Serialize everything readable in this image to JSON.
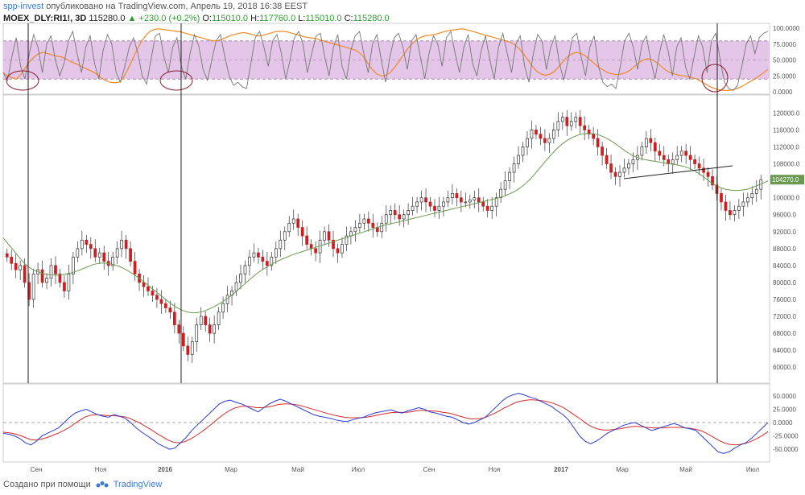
{
  "header": {
    "author": "spp-invest",
    "published_text": "опубликовано на TradingView.com, Апрель 19, 2018 16:38 EEST",
    "symbol": "MOEX_DLY:RI1!, 3D",
    "last": "115280.0",
    "change": "▲ +230.0 (+0.2%)",
    "open_label": "O:",
    "open": "115010.0",
    "high_label": "H:",
    "high": "117760.0",
    "low_label": "L:",
    "low": "115010.0",
    "close_label": "C:",
    "close": "115280.0"
  },
  "footer": {
    "created_with": "Создано при помощи",
    "brand": "TradingView",
    "logo_icon": "tradingview-logo-icon"
  },
  "colors": {
    "bull": "#7a9a5a",
    "bear": "#cc1f1f",
    "ma": "#6a9a50",
    "stoch_k": "#777777",
    "stoch_d": "#f08a24",
    "stoch_band": "#e4c6e8",
    "macd": "#2b3bd6",
    "signal": "#d62b2b",
    "price_tag": "#6a9a50"
  },
  "chart_data": [
    {
      "type": "line",
      "panel": "stochastic",
      "y_ticks": [
        "100.0000",
        "75.0000",
        "50.0000",
        "25.0000",
        "0.0000"
      ],
      "ylim": [
        0,
        100
      ],
      "bands": [
        20,
        80
      ],
      "series": [
        {
          "key": "k",
          "values": [
            30,
            18,
            55,
            85,
            40,
            20,
            60,
            90,
            70,
            30,
            75,
            88,
            50,
            25,
            45,
            80,
            95,
            60,
            30,
            70,
            88,
            45,
            20,
            65,
            90,
            75,
            30,
            15,
            40,
            70,
            85,
            60,
            25,
            12,
            50,
            88,
            92,
            55,
            30,
            70,
            85,
            40,
            20,
            60,
            90,
            72,
            35,
            18,
            50,
            80,
            90,
            55,
            25,
            10,
            15,
            8,
            5,
            45,
            85,
            95,
            70,
            40,
            80,
            90,
            60,
            20,
            50,
            85,
            95,
            75,
            30,
            60,
            88,
            92,
            55,
            25,
            70,
            90,
            40,
            20,
            65,
            88,
            95,
            60,
            30,
            75,
            90,
            50,
            15,
            55,
            85,
            92,
            70,
            35,
            80,
            90,
            55,
            20,
            60,
            88,
            75,
            40,
            85,
            95,
            60,
            30,
            70,
            90,
            45,
            25,
            65,
            88,
            50,
            20,
            70,
            92,
            60,
            30,
            75,
            88,
            40,
            15,
            60,
            90,
            80,
            35,
            70,
            88,
            45,
            18,
            50,
            85,
            92,
            55,
            25,
            70,
            88,
            40,
            15,
            8,
            12,
            5,
            40,
            80,
            92,
            70,
            35,
            75,
            88,
            50,
            20,
            60,
            90,
            65,
            25,
            70,
            85,
            40,
            20,
            55,
            88,
            70,
            30,
            80,
            92,
            50,
            15,
            5,
            2,
            10,
            40,
            75,
            88,
            60,
            85,
            92,
            95
          ]
        },
        {
          "key": "d",
          "values": [
            30,
            25,
            22,
            20,
            28,
            38,
            48,
            55,
            60,
            62,
            60,
            58,
            56,
            55,
            52,
            48,
            45,
            42,
            38,
            35,
            32,
            28,
            22,
            18,
            15,
            14,
            15,
            22,
            35,
            50,
            65,
            78,
            88,
            95,
            98,
            99,
            98,
            97,
            96,
            95,
            94,
            92,
            90,
            88,
            86,
            84,
            82,
            80,
            80,
            82,
            85,
            88,
            90,
            92,
            93,
            92,
            90,
            88,
            88,
            90,
            92,
            94,
            95,
            95,
            94,
            92,
            90,
            88,
            86,
            85,
            84,
            82,
            80,
            78,
            76,
            74,
            72,
            70,
            68,
            66,
            62,
            55,
            45,
            35,
            28,
            25,
            26,
            30,
            38,
            48,
            58,
            68,
            76,
            82,
            86,
            88,
            89,
            90,
            92,
            94,
            96,
            97,
            98,
            99,
            98,
            96,
            94,
            92,
            90,
            88,
            86,
            84,
            82,
            80,
            78,
            74,
            68,
            60,
            50,
            40,
            32,
            28,
            26,
            28,
            32,
            40,
            48,
            55,
            60,
            62,
            60,
            56,
            50,
            44,
            38,
            34,
            30,
            28,
            27,
            28,
            30,
            34,
            40,
            46,
            50,
            52,
            50,
            46,
            40,
            34,
            30,
            28,
            26,
            25,
            24,
            22,
            20,
            16,
            12,
            8,
            5,
            3,
            2,
            2,
            3,
            5,
            8,
            12,
            16,
            20,
            25,
            30,
            35
          ]
        }
      ]
    },
    {
      "type": "candlestick",
      "panel": "price",
      "y_ticks": [
        "120000.0",
        "116000.0",
        "112000.0",
        "108000.0",
        "104000.0",
        "100000.0",
        "96000.0",
        "92000.0",
        "88000.0",
        "84000.0",
        "80000.0",
        "76000.0",
        "72000.0",
        "68000.0",
        "64000.0",
        "60000.0"
      ],
      "ylim": [
        57000,
        123500
      ],
      "x_ticks": [
        "Сен",
        "Ноя",
        "2016",
        "Мар",
        "Май",
        "Июл",
        "Сен",
        "Ноя",
        "2017",
        "Мар",
        "Май",
        "Июл"
      ],
      "last_price_tag": "104270.0",
      "closes": [
        86000,
        84500,
        83000,
        84000,
        80000,
        76000,
        82000,
        83000,
        80000,
        81000,
        84000,
        82000,
        80000,
        78000,
        82000,
        86000,
        88000,
        90000,
        89000,
        88000,
        86000,
        87000,
        85000,
        84000,
        86000,
        88000,
        90000,
        88000,
        85000,
        82000,
        80000,
        79000,
        78000,
        77000,
        76000,
        75000,
        74000,
        73000,
        70000,
        68000,
        65000,
        63000,
        66000,
        70000,
        72000,
        70000,
        68000,
        70000,
        73000,
        75000,
        77000,
        78000,
        80000,
        82000,
        84000,
        86000,
        87000,
        86000,
        85000,
        84000,
        86000,
        88000,
        90000,
        92000,
        94000,
        95000,
        93000,
        91000,
        89000,
        88000,
        87000,
        90000,
        92000,
        90000,
        88000,
        87000,
        89000,
        91000,
        92000,
        93000,
        94000,
        95000,
        94000,
        93000,
        92000,
        94000,
        96000,
        97000,
        96000,
        95000,
        96000,
        97000,
        98000,
        99000,
        100000,
        99000,
        98000,
        97000,
        98000,
        99000,
        100000,
        101000,
        100000,
        99000,
        99000,
        99500,
        100000,
        99000,
        98000,
        97000,
        98000,
        100000,
        102000,
        104000,
        106000,
        108000,
        110000,
        112000,
        114000,
        116000,
        115000,
        114000,
        113000,
        114000,
        116000,
        118000,
        119000,
        117000,
        118000,
        119000,
        117000,
        116000,
        115000,
        114000,
        112000,
        110000,
        108000,
        106000,
        105000,
        106000,
        107000,
        108000,
        109000,
        110000,
        112000,
        114000,
        113000,
        111000,
        110000,
        109000,
        108000,
        109000,
        110000,
        111000,
        110000,
        109000,
        108000,
        107000,
        106000,
        105000,
        103000,
        101000,
        99000,
        97000,
        96000,
        97000,
        98000,
        99000,
        100000,
        101000,
        102000,
        104270
      ],
      "ma": [
        90500,
        89000,
        87500,
        86000,
        84500,
        83500,
        82800,
        82300,
        82000,
        81800,
        81700,
        81800,
        82000,
        82300,
        82700,
        83200,
        83700,
        84200,
        84500,
        84600,
        84500,
        84200,
        83800,
        83200,
        82500,
        81700,
        80800,
        79800,
        78800,
        77800,
        76800,
        75800,
        74800,
        74000,
        73400,
        73000,
        72800,
        72900,
        73200,
        73700,
        74300,
        75000,
        75800,
        76700,
        77700,
        78800,
        79900,
        81000,
        82000,
        82900,
        83700,
        84400,
        85000,
        85600,
        86100,
        86600,
        87000,
        87400,
        87800,
        88200,
        88600,
        89000,
        89400,
        89800,
        90200,
        90600,
        91000,
        91400,
        91800,
        92200,
        92600,
        93000,
        93400,
        93700,
        94000,
        94300,
        94600,
        94900,
        95200,
        95500,
        95800,
        96100,
        96400,
        96700,
        97000,
        97300,
        97600,
        97900,
        98200,
        98500,
        98800,
        99100,
        99400,
        99700,
        100000,
        100400,
        100900,
        101500,
        102300,
        103300,
        104500,
        105900,
        107400,
        108900,
        110300,
        111600,
        112700,
        113600,
        114300,
        114800,
        115100,
        115200,
        115100,
        114800,
        114300,
        113600,
        112800,
        111900,
        111000,
        110200,
        109600,
        109200,
        108900,
        108700,
        108500,
        108300,
        108100,
        107900,
        107700,
        107400,
        107000,
        106400,
        105600,
        104700,
        103800,
        103000,
        102400,
        102000,
        101800,
        101700,
        101800,
        102000,
        102400,
        102900,
        103400,
        104000
      ]
    },
    {
      "type": "line",
      "panel": "macd",
      "y_ticks": [
        "50.0000",
        "25.0000",
        "0.0000",
        "-25.0000",
        "-50.0000"
      ],
      "ylim": [
        -62,
        62
      ],
      "series": [
        {
          "key": "macd",
          "values": [
            -20,
            -22,
            -25,
            -30,
            -38,
            -42,
            -35,
            -25,
            -20,
            -15,
            -10,
            0,
            10,
            18,
            22,
            25,
            20,
            15,
            12,
            10,
            15,
            12,
            8,
            0,
            -10,
            -18,
            -25,
            -32,
            -40,
            -45,
            -50,
            -48,
            -38,
            -28,
            -15,
            -5,
            5,
            15,
            25,
            35,
            40,
            42,
            38,
            35,
            30,
            25,
            20,
            28,
            35,
            40,
            44,
            40,
            35,
            30,
            25,
            20,
            15,
            12,
            10,
            8,
            5,
            3,
            2,
            5,
            8,
            10,
            14,
            18,
            20,
            22,
            24,
            20,
            18,
            22,
            25,
            28,
            25,
            20,
            18,
            15,
            12,
            10,
            5,
            0,
            -3,
            0,
            5,
            10,
            20,
            30,
            40,
            48,
            52,
            55,
            52,
            48,
            45,
            40,
            35,
            30,
            22,
            15,
            5,
            -10,
            -25,
            -35,
            -40,
            -35,
            -28,
            -20,
            -15,
            -10,
            -5,
            -2,
            0,
            -5,
            -10,
            -15,
            -12,
            -8,
            -5,
            -2,
            -5,
            -10,
            -12,
            -15,
            -25,
            -35,
            -45,
            -55,
            -58,
            -55,
            -48,
            -42,
            -38,
            -30,
            -20,
            -10,
            0
          ]
        },
        {
          "key": "signal",
          "values": [
            -18,
            -19,
            -21,
            -24,
            -28,
            -32,
            -33,
            -31,
            -28,
            -24,
            -20,
            -15,
            -9,
            -2,
            5,
            11,
            14,
            15,
            14,
            13,
            13,
            12,
            11,
            8,
            3,
            -2,
            -8,
            -14,
            -21,
            -27,
            -33,
            -37,
            -38,
            -36,
            -31,
            -25,
            -18,
            -10,
            -2,
            7,
            15,
            22,
            27,
            30,
            31,
            30,
            28,
            28,
            29,
            31,
            34,
            35,
            35,
            34,
            32,
            29,
            26,
            23,
            20,
            17,
            14,
            12,
            10,
            9,
            9,
            9,
            10,
            12,
            14,
            16,
            18,
            19,
            19,
            19,
            20,
            22,
            23,
            22,
            22,
            21,
            19,
            18,
            15,
            12,
            9,
            7,
            7,
            8,
            11,
            16,
            21,
            27,
            32,
            37,
            40,
            42,
            43,
            42,
            41,
            39,
            36,
            32,
            27,
            20,
            13,
            6,
            -2,
            -8,
            -12,
            -14,
            -14,
            -13,
            -12,
            -10,
            -8,
            -7,
            -8,
            -9,
            -10,
            -10,
            -10,
            -9,
            -9,
            -9,
            -10,
            -11,
            -13,
            -16,
            -21,
            -27,
            -33,
            -38,
            -41,
            -42,
            -41,
            -39,
            -35,
            -30,
            -24,
            -17
          ]
        }
      ]
    }
  ]
}
